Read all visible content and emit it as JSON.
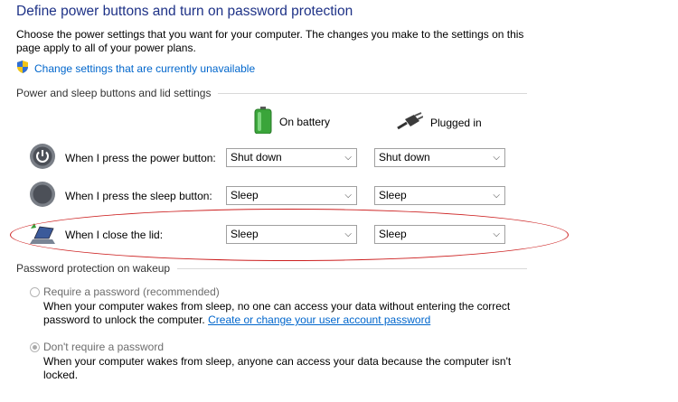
{
  "header": {
    "title": "Define power buttons and turn on password protection",
    "intro": "Choose the power settings that you want for your computer. The changes you make to the settings on this page apply to all of your power plans.",
    "change_link": "Change settings that are currently unavailable"
  },
  "buttons_section": {
    "heading": "Power and sleep buttons and lid settings",
    "col_battery": "On battery",
    "col_plugged": "Plugged in",
    "rows": [
      {
        "label": "When I press the power button:",
        "battery": "Shut down",
        "plugged": "Shut down",
        "icon": "power-button-icon"
      },
      {
        "label": "When I press the sleep button:",
        "battery": "Sleep",
        "plugged": "Sleep",
        "icon": "sleep-button-icon"
      },
      {
        "label": "When I close the lid:",
        "battery": "Sleep",
        "plugged": "Sleep",
        "icon": "laptop-lid-icon"
      }
    ]
  },
  "password_section": {
    "heading": "Password protection on wakeup",
    "option_require": {
      "label": "Require a password (recommended)",
      "desc": "When your computer wakes from sleep, no one can access your data without entering the correct password to unlock the computer.",
      "link": "Create or change your user account password",
      "selected": false
    },
    "option_dont": {
      "label": "Don't require a password",
      "desc": "When your computer wakes from sleep, anyone can access your data because the computer isn't locked.",
      "selected": true
    }
  },
  "colors": {
    "title": "#1e3287",
    "link": "#0066cc",
    "highlight_ellipse": "#cc1f1f"
  }
}
